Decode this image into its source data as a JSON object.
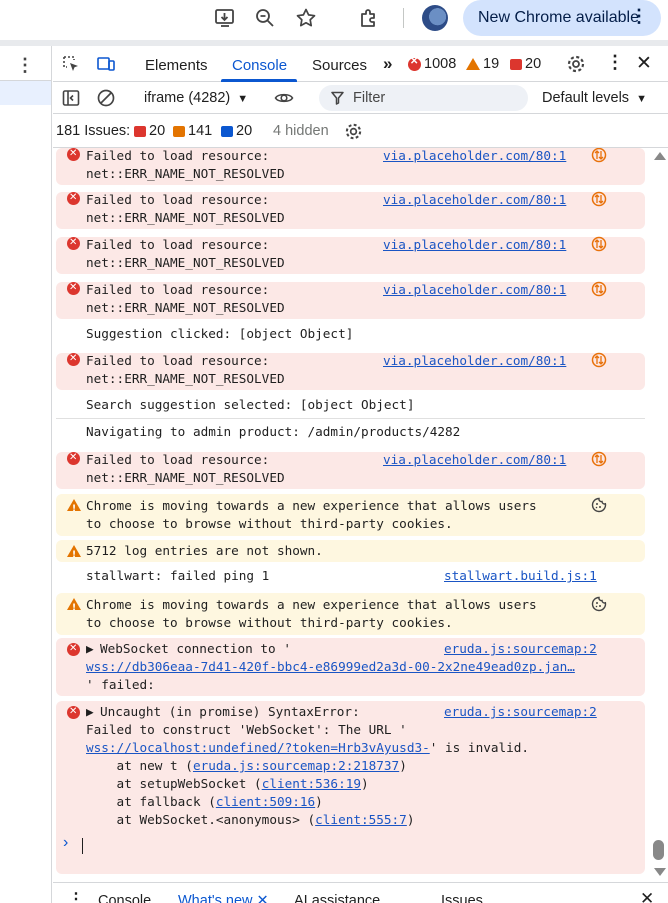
{
  "browser": {
    "update_label": "New Chrome available",
    "menu_icon": "more-vert-icon"
  },
  "devtools": {
    "tabs": [
      "Elements",
      "Console",
      "Sources"
    ],
    "active_tab": "Console",
    "counts": {
      "errors": "1008",
      "warnings": "19",
      "issues": "20"
    },
    "toolbar": {
      "context": "iframe (4282)",
      "filter_placeholder": "Filter",
      "levels": "Default levels"
    },
    "issues_bar": {
      "label": "181 Issues:",
      "red": "20",
      "orange": "141",
      "blue": "20",
      "hidden": "4 hidden"
    },
    "messages": [
      {
        "type": "error",
        "l1": "Failed to load resource:",
        "l2": "net::ERR_NAME_NOT_RESOLVED",
        "src": "via.placeholder.com/80:1"
      },
      {
        "type": "error",
        "l1": "Failed to load resource:",
        "l2": "net::ERR_NAME_NOT_RESOLVED",
        "src": "via.placeholder.com/80:1"
      },
      {
        "type": "error",
        "l1": "Failed to load resource:",
        "l2": "net::ERR_NAME_NOT_RESOLVED",
        "src": "via.placeholder.com/80:1"
      },
      {
        "type": "error",
        "l1": "Failed to load resource:",
        "l2": "net::ERR_NAME_NOT_RESOLVED",
        "src": "via.placeholder.com/80:1"
      },
      {
        "type": "info",
        "l1": "Suggestion clicked: [object Object]"
      },
      {
        "type": "error",
        "l1": "Failed to load resource:",
        "l2": "net::ERR_NAME_NOT_RESOLVED",
        "src": "via.placeholder.com/80:1"
      },
      {
        "type": "info",
        "l1": "Search suggestion selected: [object Object]"
      },
      {
        "type": "info",
        "l1": "Navigating to admin product: /admin/products/4282"
      },
      {
        "type": "error",
        "l1": "Failed to load resource:",
        "l2": "net::ERR_NAME_NOT_RESOLVED",
        "src": "via.placeholder.com/80:1"
      },
      {
        "type": "warning",
        "l1": "Chrome is moving towards a new experience that allows users",
        "l2": "to choose to browse without third-party cookies."
      },
      {
        "type": "warning",
        "l1": "5712 log entries are not shown."
      },
      {
        "type": "info",
        "l1": "stallwart: failed ping 1",
        "src": "stallwart.build.js:1"
      },
      {
        "type": "warning",
        "l1": "Chrome is moving towards a new experience that allows users",
        "l2": "to choose to browse without third-party cookies."
      },
      {
        "type": "error",
        "l1": "WebSocket connection to '",
        "l2": "wss://db306eaa-7d41-420f-bbc4-e86999ed2a3d-00-2x2ne49ead0zp.jan…",
        "l3": "' failed:",
        "src": "eruda.js:sourcemap:2"
      },
      {
        "type": "error",
        "l1": "Uncaught (in promise) SyntaxError:",
        "l2": "Failed to construct 'WebSocket': The URL '",
        "l3_link": "wss://localhost:undefined/?token=Hrb3vAyusd3-",
        "l3_rest": "' is invalid.",
        "src": "eruda.js:sourcemap:2",
        "stack": [
          {
            "prefix": "    at new t (",
            "link": "eruda.js:sourcemap:2:218737",
            "suffix": ")"
          },
          {
            "prefix": "    at setupWebSocket (",
            "link": "client:536:19",
            "suffix": ")"
          },
          {
            "prefix": "    at fallback (",
            "link": "client:509:16",
            "suffix": ")"
          },
          {
            "prefix": "    at WebSocket.<anonymous> (",
            "link": "client:555:7",
            "suffix": ")"
          }
        ]
      }
    ],
    "drawer": {
      "tabs": [
        "Console",
        "What's new",
        "AI assistance",
        "Issues"
      ]
    }
  }
}
